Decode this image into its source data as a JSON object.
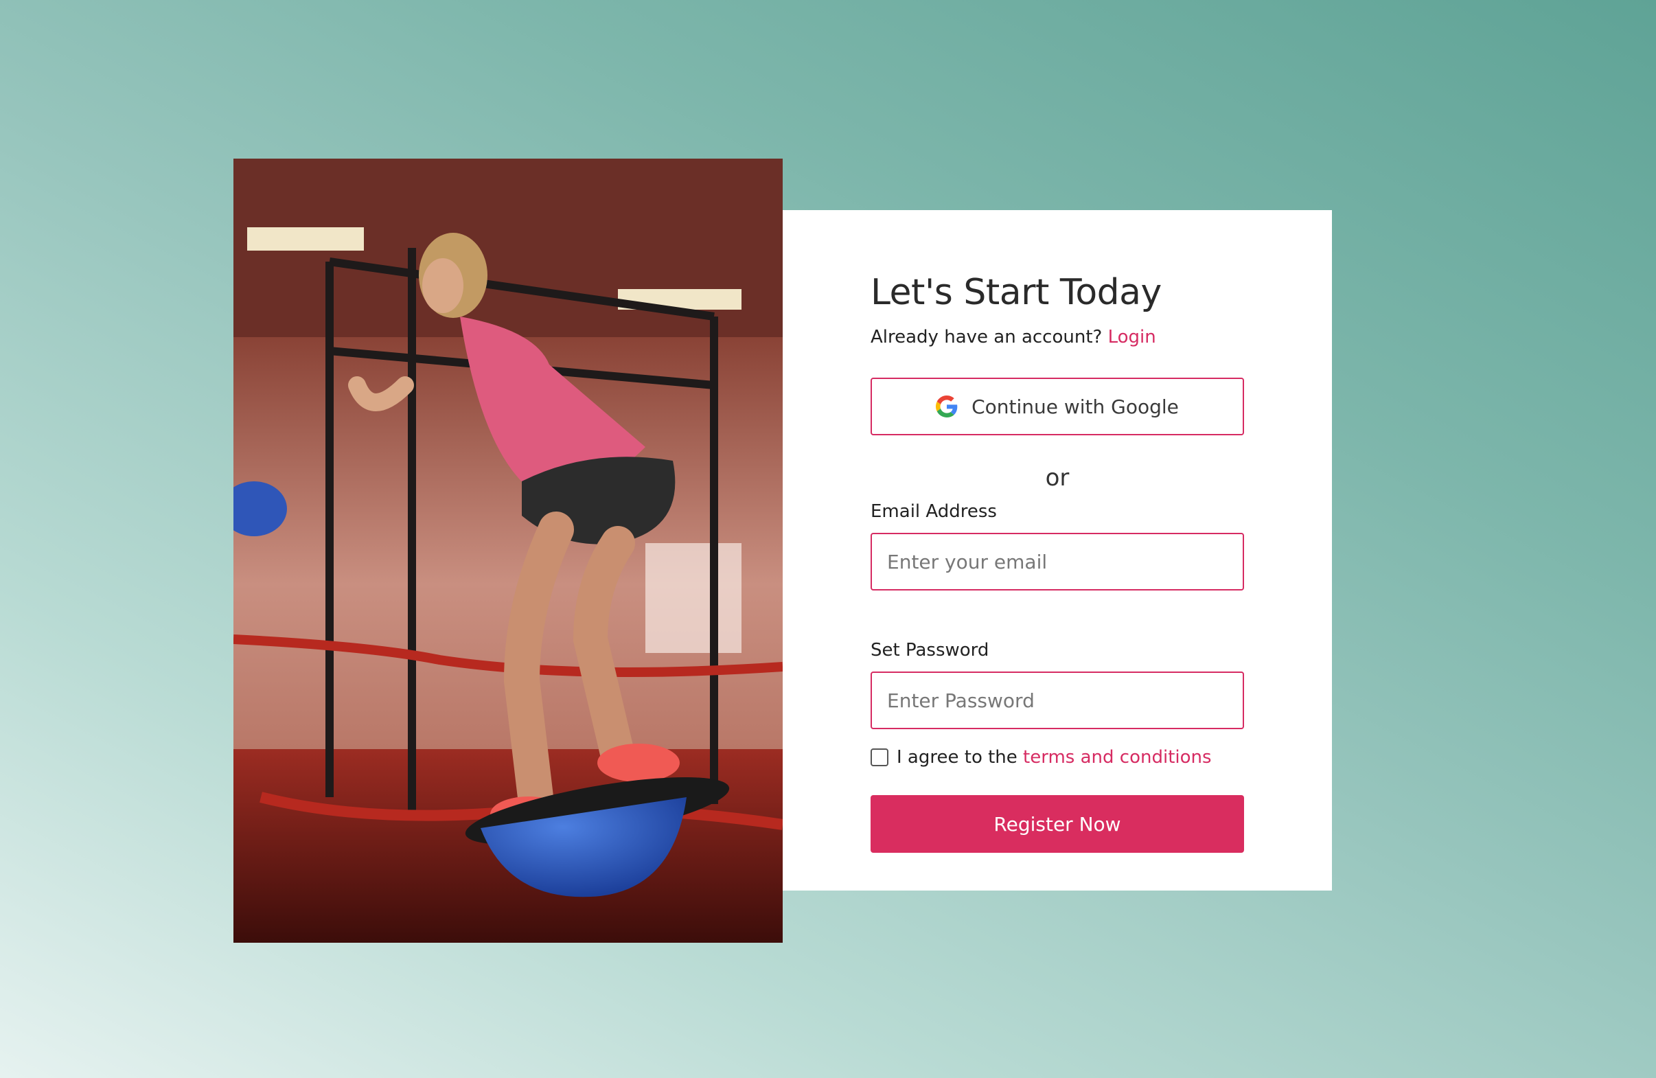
{
  "photo": {
    "alt": "Woman training on a balance ball in a gym",
    "icon": "fitness-photo"
  },
  "form": {
    "title": "Let's Start Today",
    "subtitle_prefix": "Already have an account?",
    "login_link": "Login",
    "google_button": "Continue with Google",
    "divider": "or",
    "email_label": "Email Address",
    "email_placeholder": "Enter your email",
    "email_value": "",
    "password_label": "Set Password",
    "password_placeholder": "Enter Password",
    "password_value": "",
    "agree_prefix": "I agree to the",
    "terms_link": "terms and conditions",
    "terms_checked": false,
    "register_button": "Register Now"
  },
  "colors": {
    "accent": "#d62b62",
    "button": "#d92d5f",
    "card": "#ffffff",
    "background_start": "#e6f2f0",
    "background_end": "#5fa396"
  }
}
